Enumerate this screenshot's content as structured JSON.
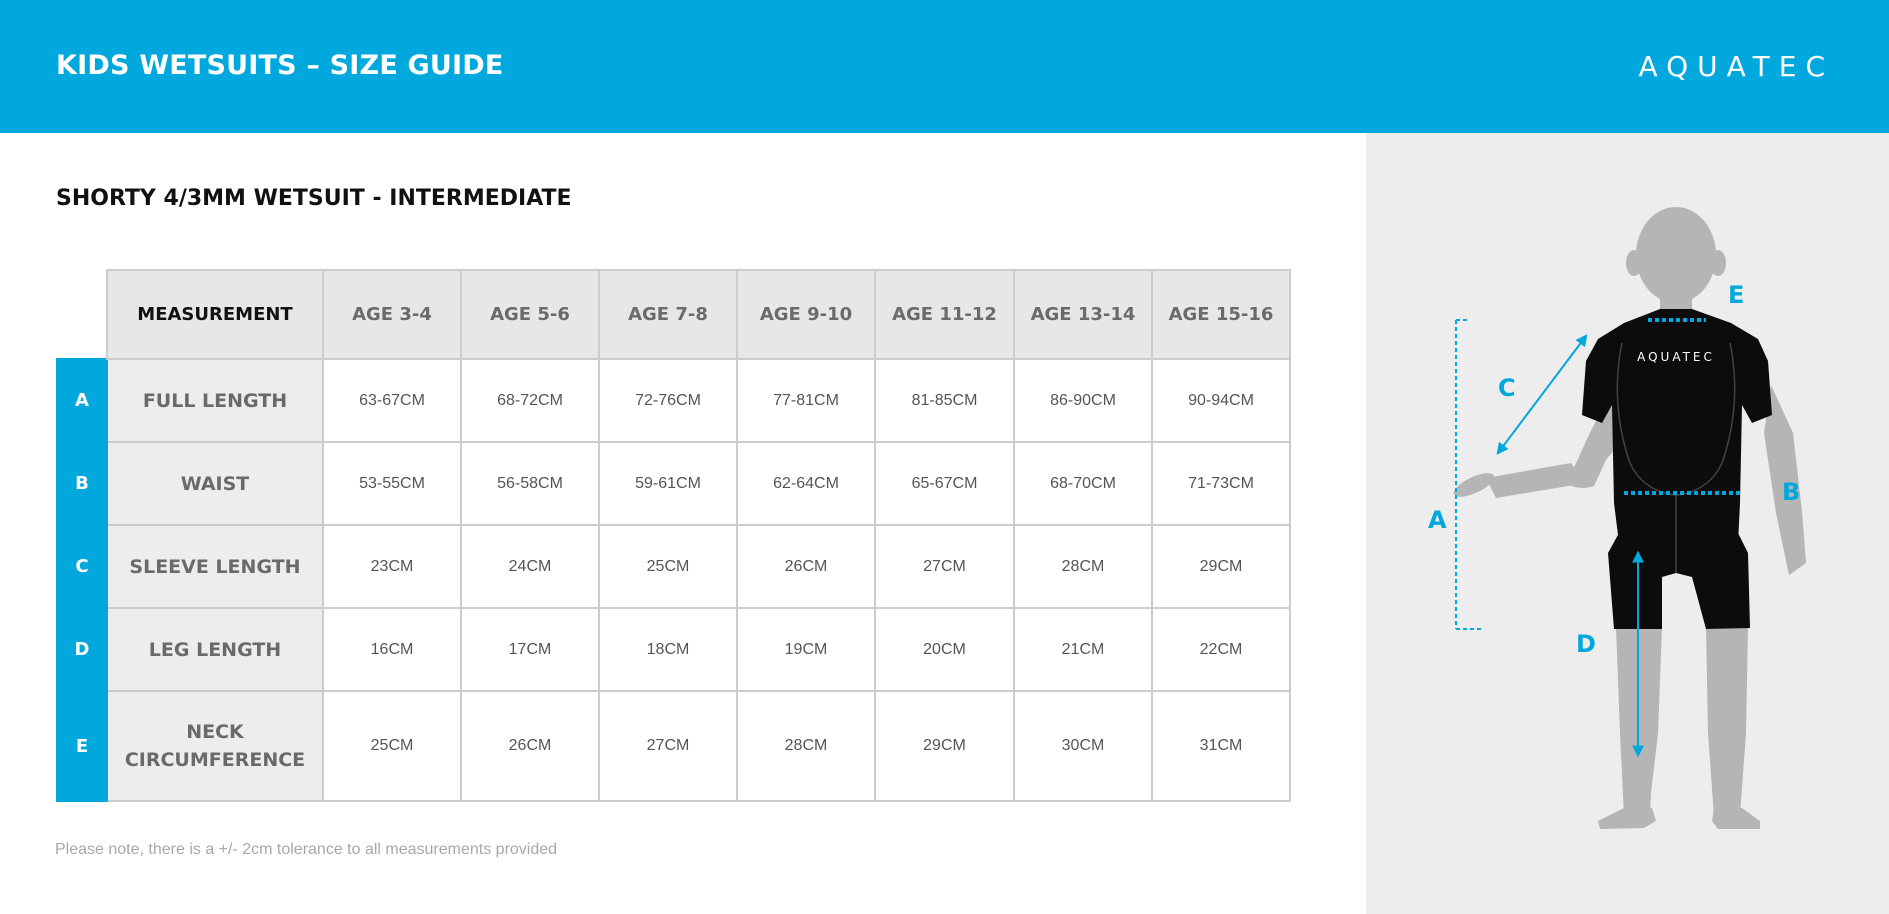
{
  "header": {
    "title": "KIDS WETSUITS – SIZE GUIDE",
    "brand": "AQUATEC"
  },
  "product": {
    "title": "SHORTY 4/3MM WETSUIT - INTERMEDIATE"
  },
  "table": {
    "columns": [
      "MEASUREMENT",
      "AGE 3-4",
      "AGE 5-6",
      "AGE 7-8",
      "AGE 9-10",
      "AGE 11-12",
      "AGE 13-14",
      "AGE 15-16"
    ],
    "rows": [
      {
        "letter": "A",
        "label": "FULL LENGTH",
        "values": [
          "63-67CM",
          "68-72CM",
          "72-76CM",
          "77-81CM",
          "81-85CM",
          "86-90CM",
          "90-94CM"
        ]
      },
      {
        "letter": "B",
        "label": "WAIST",
        "values": [
          "53-55CM",
          "56-58CM",
          "59-61CM",
          "62-64CM",
          "65-67CM",
          "68-70CM",
          "71-73CM"
        ]
      },
      {
        "letter": "C",
        "label": "SLEEVE LENGTH",
        "values": [
          "23CM",
          "24CM",
          "25CM",
          "26CM",
          "27CM",
          "28CM",
          "29CM"
        ]
      },
      {
        "letter": "D",
        "label": "LEG LENGTH",
        "values": [
          "16CM",
          "17CM",
          "18CM",
          "19CM",
          "20CM",
          "21CM",
          "22CM"
        ]
      },
      {
        "letter": "E",
        "label_line1": "NECK",
        "label_line2": "CIRCUMFERENCE",
        "values": [
          "25CM",
          "26CM",
          "27CM",
          "28CM",
          "29CM",
          "30CM",
          "31CM"
        ]
      }
    ]
  },
  "footnote": "Please note, there is a +/- 2cm tolerance to all measurements provided",
  "diagram": {
    "suit_logo": "AQUATEC",
    "markers": [
      "A",
      "B",
      "C",
      "D",
      "E"
    ],
    "accent_color": "#00a8dd",
    "figure_color": "#b5b5b5",
    "suit_color": "#0c0c0c"
  }
}
